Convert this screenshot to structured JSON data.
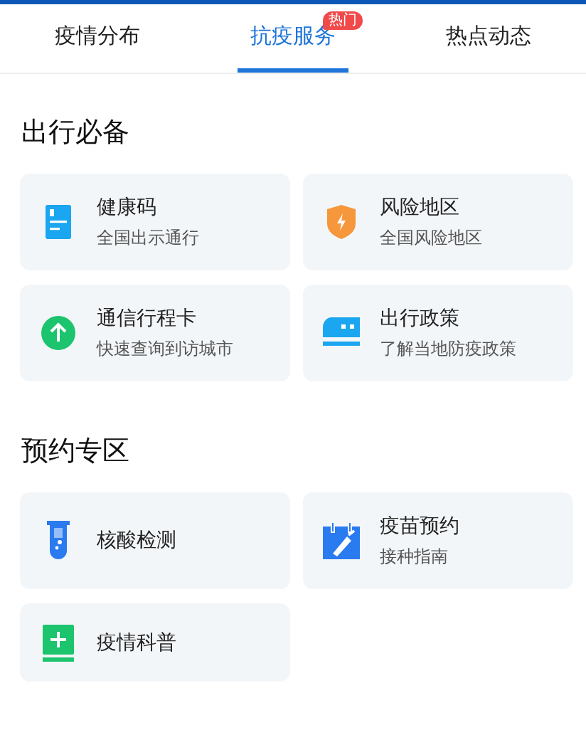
{
  "tabs": [
    {
      "label": "疫情分布",
      "selected": false
    },
    {
      "label": "抗疫服务",
      "selected": true,
      "badge": "热门"
    },
    {
      "label": "热点动态",
      "selected": false
    }
  ],
  "sections": [
    {
      "title": "出行必备",
      "items": [
        {
          "kind": "card",
          "title": "健康码",
          "subtitle": "全国出示通行"
        },
        {
          "kind": "shield",
          "title": "风险地区",
          "subtitle": "全国风险地区"
        },
        {
          "kind": "arrow",
          "title": "通信行程卡",
          "subtitle": "快速查询到访城市"
        },
        {
          "kind": "train",
          "title": "出行政策",
          "subtitle": "了解当地防疫政策"
        }
      ]
    },
    {
      "title": "预约专区",
      "items": [
        {
          "kind": "tube",
          "title": "核酸检测"
        },
        {
          "kind": "calendar",
          "title": "疫苗预约",
          "subtitle": "接种指南"
        },
        {
          "kind": "book",
          "title": "疫情科普"
        }
      ]
    }
  ]
}
